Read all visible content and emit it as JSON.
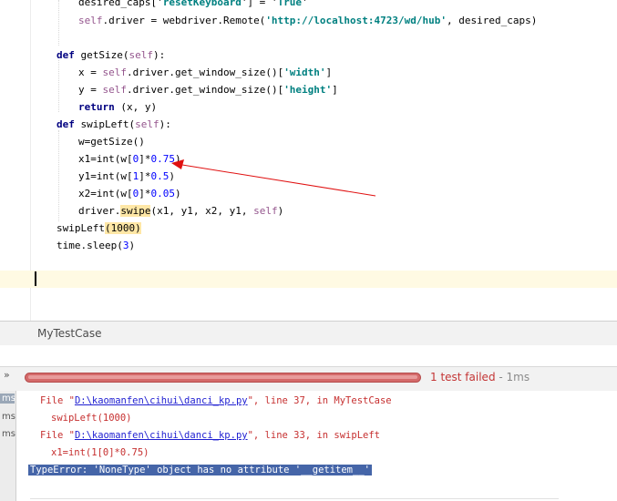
{
  "editor": {
    "lines": [
      {
        "text_a": "desired_caps['",
        "text_b": "resetKeyboard",
        "text_c": "'] = '",
        "text_d": "True",
        "text_e": "'"
      },
      {
        "self": "self",
        "text_a": ".driver = webdriver.Remote(",
        "str": "'http://localhost:4723/wd/hub'",
        "text_b": ", desired_caps)"
      },
      {
        "kw": "def",
        "text": " getSize(",
        "self": "self",
        "text_b": "):"
      },
      {
        "text_a": "x = ",
        "self": "self",
        "text_b": ".driver.get_window_size()[",
        "str": "'width'",
        "text_c": "]"
      },
      {
        "text_a": "y = ",
        "self": "self",
        "text_b": ".driver.get_window_size()[",
        "str": "'height'",
        "text_c": "]"
      },
      {
        "kw": "return",
        "text": " (x, y)"
      },
      {
        "kw": "def",
        "text": " swipLeft(",
        "self": "self",
        "text_b": "):"
      },
      {
        "text": "w=getSize()"
      },
      {
        "text_a": "x1=int(w[",
        "n1": "0",
        "text_b": "]*",
        "n2": "0.75",
        "text_c": ")"
      },
      {
        "text_a": "y1=int(w[",
        "n1": "1",
        "text_b": "]*",
        "n2": "0.5",
        "text_c": ")"
      },
      {
        "text_a": "x2=int(w[",
        "n1": "0",
        "text_b": "]*",
        "n2": "0.05",
        "text_c": ")"
      },
      {
        "text_a": "driver.",
        "hl": "swipe",
        "text_b": "(x1, y1, x2, y1, ",
        "self": "self",
        "text_c": ")"
      },
      {
        "text_a": "swipLeft",
        "hl_num": "(1000)"
      },
      {
        "text_a": "time.sleep(",
        "n1": "3",
        "text_c": ")"
      }
    ]
  },
  "run_panel": {
    "title": "MyTestCase",
    "status_failed": "1 test failed",
    "status_separator": " - ",
    "status_time": "1ms",
    "collapse_icon": "collapse-expand-icon",
    "progress_fraction": 1.0,
    "progress_color": "#d46a6a",
    "tree_times": [
      "ms",
      "ms",
      "ms"
    ]
  },
  "console": {
    "line1_prefix": "File \"",
    "line1_link": "D:\\kaomanfen\\cihui\\danci_kp.py",
    "line1_suffix": "\", line 37, in MyTestCase",
    "line2": "swipLeft(1000)",
    "line3_prefix": "File \"",
    "line3_link": "D:\\kaomanfen\\cihui\\danci_kp.py",
    "line3_suffix": "\", line 33, in swipLeft",
    "line4": "x1=int(1[0]*0.75)",
    "error": "TypeError: 'NoneType' object has no attribute '__getitem__'"
  },
  "colors": {
    "annotation_arrow": "#e01010",
    "error_highlight": "#4565a8",
    "console_text": "#c62f2f"
  }
}
